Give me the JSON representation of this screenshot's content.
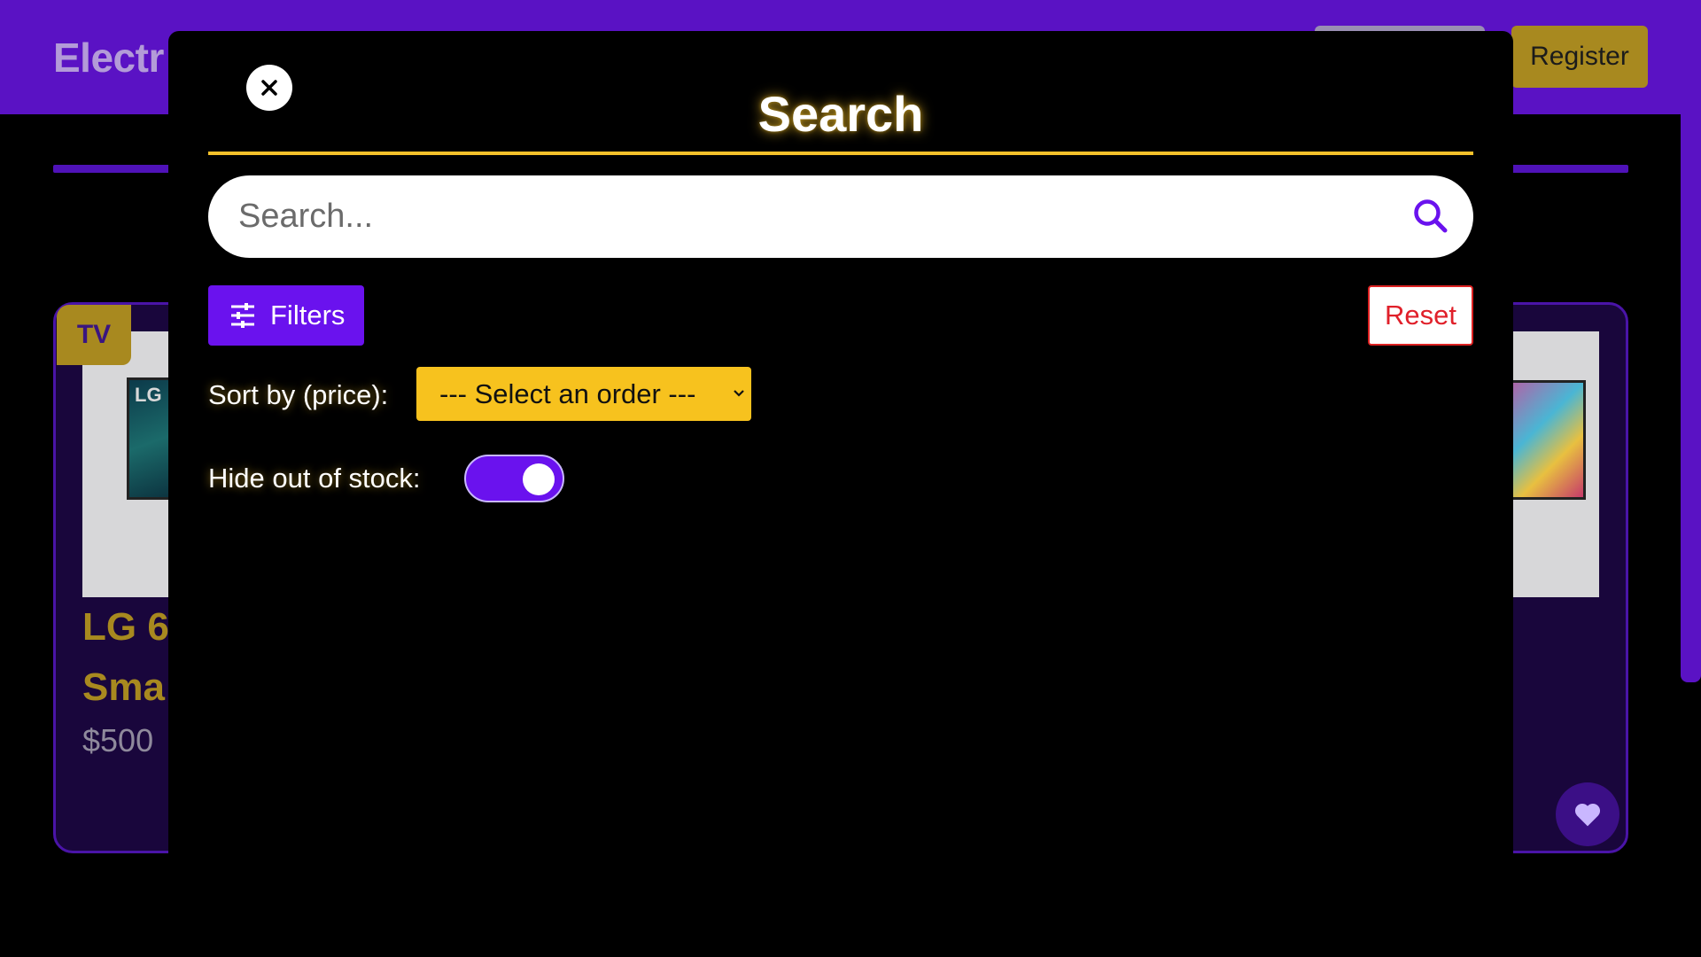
{
  "background": {
    "brand": "Electr",
    "register_label": "Register",
    "product_badge": "TV",
    "product_title_line1": "LG 6",
    "product_title_line2": "Sma",
    "product_price": "$500",
    "tv_logo": "LG"
  },
  "modal": {
    "title": "Search",
    "search": {
      "placeholder": "Search...",
      "value": ""
    },
    "filters_label": "Filters",
    "reset_label": "Reset",
    "sort_label": "Sort by (price):",
    "sort_selected": "--- Select an order ---",
    "stock_label": "Hide out of stock:",
    "hide_out_of_stock": true
  },
  "colors": {
    "accent_purple": "#6a12ee",
    "accent_yellow": "#f7c21e",
    "reset_red": "#e0202a"
  },
  "icons": [
    "close-icon",
    "search-icon",
    "filters-sliders-icon",
    "chevron-down-icon",
    "heart-icon"
  ]
}
